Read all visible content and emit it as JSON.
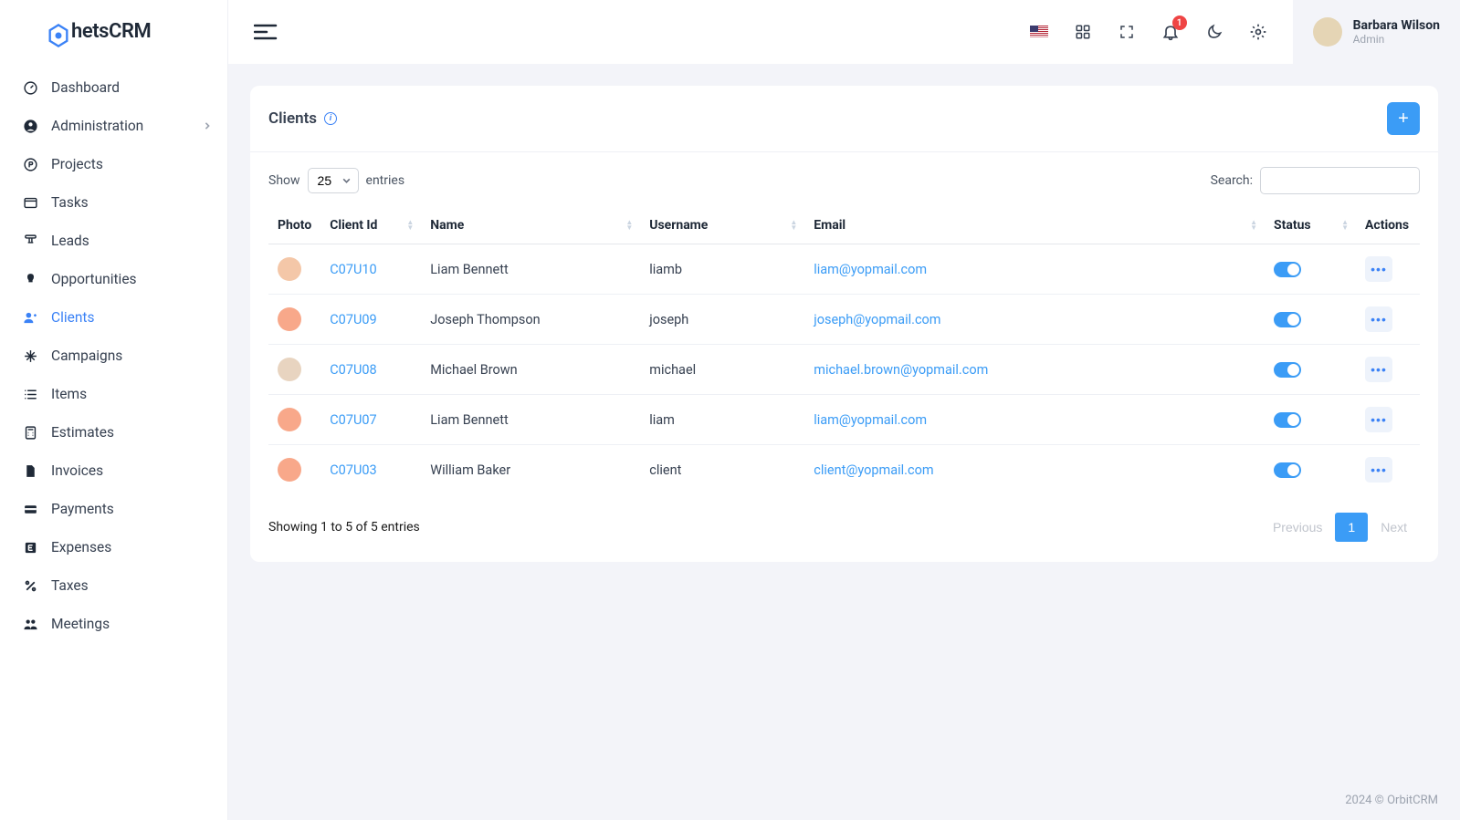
{
  "app": {
    "logo_text": "hetsCRM"
  },
  "sidebar": {
    "items": [
      {
        "label": "Dashboard"
      },
      {
        "label": "Administration"
      },
      {
        "label": "Projects"
      },
      {
        "label": "Tasks"
      },
      {
        "label": "Leads"
      },
      {
        "label": "Opportunities"
      },
      {
        "label": "Clients"
      },
      {
        "label": "Campaigns"
      },
      {
        "label": "Items"
      },
      {
        "label": "Estimates"
      },
      {
        "label": "Invoices"
      },
      {
        "label": "Payments"
      },
      {
        "label": "Expenses"
      },
      {
        "label": "Taxes"
      },
      {
        "label": "Meetings"
      }
    ]
  },
  "topbar": {
    "notification_count": "1",
    "user_name": "Barbara Wilson",
    "user_role": "Admin"
  },
  "page": {
    "title": "Clients",
    "add_icon": "+",
    "show_label": "Show",
    "entries_label": "entries",
    "page_size": "25",
    "search_label": "Search:",
    "columns": {
      "photo": "Photo",
      "client_id": "Client Id",
      "name": "Name",
      "username": "Username",
      "email": "Email",
      "status": "Status",
      "actions": "Actions"
    },
    "rows": [
      {
        "client_id": "C07U10",
        "name": "Liam Bennett",
        "username": "liamb",
        "email": "liam@yopmail.com"
      },
      {
        "client_id": "C07U09",
        "name": "Joseph Thompson",
        "username": "joseph",
        "email": "joseph@yopmail.com"
      },
      {
        "client_id": "C07U08",
        "name": "Michael Brown",
        "username": "michael",
        "email": "michael.brown@yopmail.com"
      },
      {
        "client_id": "C07U07",
        "name": "Liam Bennett",
        "username": "liam",
        "email": "liam@yopmail.com"
      },
      {
        "client_id": "C07U03",
        "name": "William Baker",
        "username": "client",
        "email": "client@yopmail.com"
      }
    ],
    "showing_text": "Showing 1 to 5 of 5 entries",
    "pagination": {
      "prev": "Previous",
      "next": "Next",
      "current": "1"
    }
  },
  "footer": {
    "text": "2024 © OrbitCRM"
  }
}
